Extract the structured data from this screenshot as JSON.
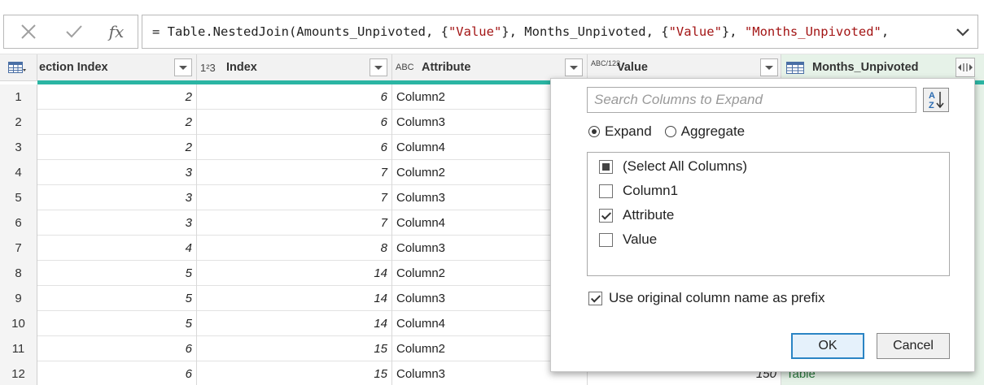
{
  "formula_bar": {
    "cancel_icon": "x-icon",
    "commit_icon": "check-icon",
    "fx_label": "fx",
    "formula_parts": [
      {
        "text": "= Table.NestedJoin(Amounts_Unpivoted, {",
        "kind": "plain"
      },
      {
        "text": "\"Value\"",
        "kind": "string"
      },
      {
        "text": "}, Months_Unpivoted, {",
        "kind": "plain"
      },
      {
        "text": "\"Value\"",
        "kind": "string"
      },
      {
        "text": "}, ",
        "kind": "plain"
      },
      {
        "text": "\"Months_Unpivoted\"",
        "kind": "string"
      },
      {
        "text": ",",
        "kind": "plain"
      }
    ]
  },
  "columns": {
    "section_index": {
      "label": "ection Index"
    },
    "index": {
      "label": "Index",
      "type_icon": "1²3"
    },
    "attribute": {
      "label": "Attribute",
      "type_icon": "ABC"
    },
    "value": {
      "label": "Value",
      "type_icon": "ABC/123"
    },
    "months_unpivoted": {
      "label": "Months_Unpivoted",
      "type_icon": "table-icon"
    }
  },
  "rows": [
    {
      "n": "1",
      "section_index": "2",
      "index": "6",
      "attribute": "Column2",
      "value": "",
      "months": ""
    },
    {
      "n": "2",
      "section_index": "2",
      "index": "6",
      "attribute": "Column3",
      "value": "",
      "months": ""
    },
    {
      "n": "3",
      "section_index": "2",
      "index": "6",
      "attribute": "Column4",
      "value": "",
      "months": ""
    },
    {
      "n": "4",
      "section_index": "3",
      "index": "7",
      "attribute": "Column2",
      "value": "",
      "months": ""
    },
    {
      "n": "5",
      "section_index": "3",
      "index": "7",
      "attribute": "Column3",
      "value": "",
      "months": ""
    },
    {
      "n": "6",
      "section_index": "3",
      "index": "7",
      "attribute": "Column4",
      "value": "",
      "months": ""
    },
    {
      "n": "7",
      "section_index": "4",
      "index": "8",
      "attribute": "Column3",
      "value": "",
      "months": ""
    },
    {
      "n": "8",
      "section_index": "5",
      "index": "14",
      "attribute": "Column2",
      "value": "",
      "months": ""
    },
    {
      "n": "9",
      "section_index": "5",
      "index": "14",
      "attribute": "Column3",
      "value": "",
      "months": ""
    },
    {
      "n": "10",
      "section_index": "5",
      "index": "14",
      "attribute": "Column4",
      "value": "",
      "months": ""
    },
    {
      "n": "11",
      "section_index": "6",
      "index": "15",
      "attribute": "Column2",
      "value": "",
      "months": ""
    },
    {
      "n": "12",
      "section_index": "6",
      "index": "15",
      "attribute": "Column3",
      "value": "150",
      "months": "Table"
    }
  ],
  "expand_popup": {
    "search_placeholder": "Search Columns to Expand",
    "mode_expand": "Expand",
    "mode_aggregate": "Aggregate",
    "selected_mode": "Expand",
    "columns": [
      {
        "label": "(Select All Columns)",
        "state": "partial"
      },
      {
        "label": "Column1",
        "state": "unchecked"
      },
      {
        "label": "Attribute",
        "state": "checked"
      },
      {
        "label": "Value",
        "state": "unchecked"
      }
    ],
    "prefix_label": "Use original column name as prefix",
    "prefix_checked": true,
    "ok_label": "OK",
    "cancel_label": "Cancel"
  },
  "colors": {
    "accent_teal": "#2bb5a3",
    "table_column_bg": "#e6f2e8",
    "table_link": "#2b7a3e",
    "ok_border": "#2a84c4",
    "formula_string": "#a31515"
  }
}
